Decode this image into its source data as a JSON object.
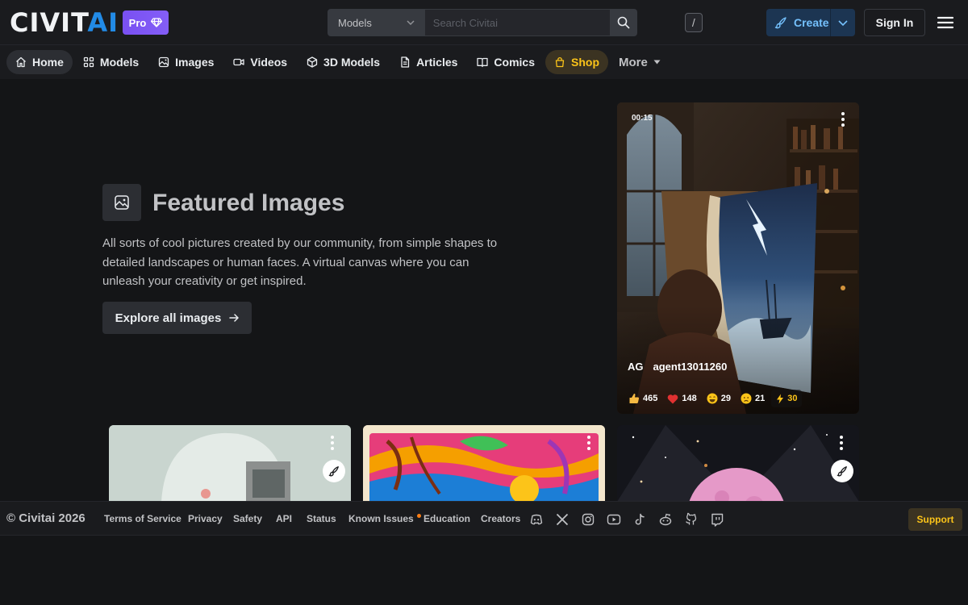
{
  "header": {
    "logo_part1": "CIVIT",
    "logo_part2": "AI",
    "pro_label": "Pro",
    "search_category": "Models",
    "search_placeholder": "Search Civitai",
    "search_shortcut": "/",
    "create_label": "Create",
    "signin_label": "Sign In"
  },
  "nav": {
    "items": [
      {
        "label": "Home",
        "icon": "home-icon"
      },
      {
        "label": "Models",
        "icon": "grid-icon"
      },
      {
        "label": "Images",
        "icon": "image-icon"
      },
      {
        "label": "Videos",
        "icon": "video-icon"
      },
      {
        "label": "3D Models",
        "icon": "cube-icon"
      },
      {
        "label": "Articles",
        "icon": "file-icon"
      },
      {
        "label": "Comics",
        "icon": "book-icon"
      },
      {
        "label": "Shop",
        "icon": "shopping-bag-icon"
      }
    ],
    "more_label": "More"
  },
  "hero": {
    "title": "Featured Images",
    "description": "All sorts of cool pictures created by our community, from simple shapes to detailed landscapes or human faces. A virtual canvas where you can unleash your creativity or get inspired.",
    "explore_label": "Explore all images"
  },
  "featured_card": {
    "duration": "00:15",
    "author_initials": "AG",
    "author_name": "agent13011260",
    "reactions": {
      "like": "465",
      "heart": "148",
      "laugh": "29",
      "cry": "21",
      "buzz": "30"
    }
  },
  "footer": {
    "copyright": "© Civitai 2026",
    "links": [
      "Terms of Service",
      "Privacy",
      "Safety",
      "API",
      "Status",
      "Known Issues",
      "Education",
      "Creators"
    ],
    "support_label": "Support"
  },
  "colors": {
    "background": "#141517",
    "header": "#1a1b1e",
    "accent_blue": "#228be6",
    "pro_purple": "#7950f2",
    "shop_yellow": "#fcc419"
  }
}
